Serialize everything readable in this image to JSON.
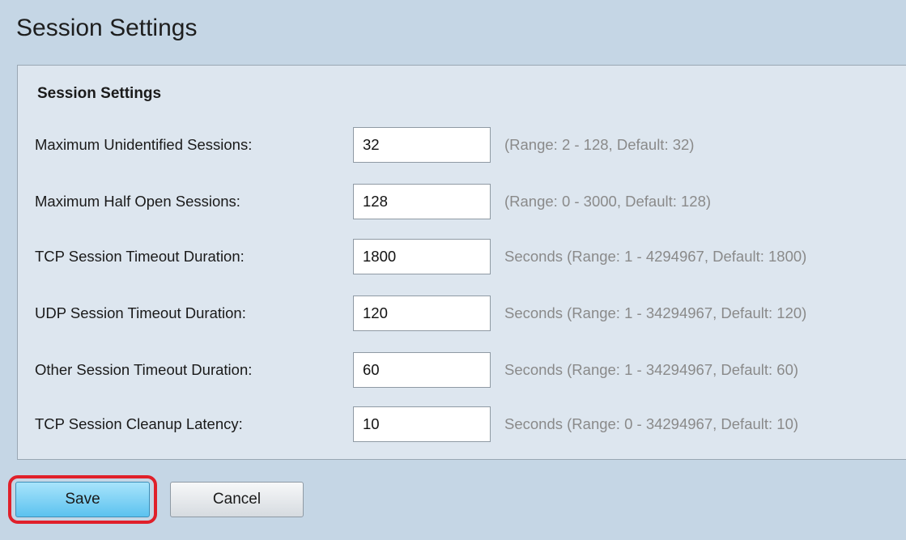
{
  "page": {
    "title": "Session Settings"
  },
  "section": {
    "title": "Session Settings"
  },
  "fields": [
    {
      "label": "Maximum Unidentified Sessions:",
      "value": "32",
      "hint": "(Range: 2 - 128, Default: 32)"
    },
    {
      "label": "Maximum Half Open Sessions:",
      "value": "128",
      "hint": "(Range: 0 - 3000, Default: 128)"
    },
    {
      "label": "TCP Session Timeout Duration:",
      "value": "1800",
      "hint": "Seconds (Range: 1 - 4294967, Default: 1800)"
    },
    {
      "label": "UDP Session Timeout Duration:",
      "value": "120",
      "hint": "Seconds (Range: 1 - 34294967, Default: 120)"
    },
    {
      "label": "Other Session Timeout Duration:",
      "value": "60",
      "hint": "Seconds (Range: 1 - 34294967, Default: 60)"
    },
    {
      "label": "TCP Session Cleanup Latency:",
      "value": "10",
      "hint": "Seconds (Range: 0 - 34294967, Default: 10)"
    }
  ],
  "buttons": {
    "save_label": "Save",
    "cancel_label": "Cancel"
  },
  "colors": {
    "background": "#c5d6e5",
    "panel": "#dde6ef",
    "hint_text": "#8a8a8a",
    "save_button": "#5cc2ef",
    "highlight": "#e0202a"
  }
}
